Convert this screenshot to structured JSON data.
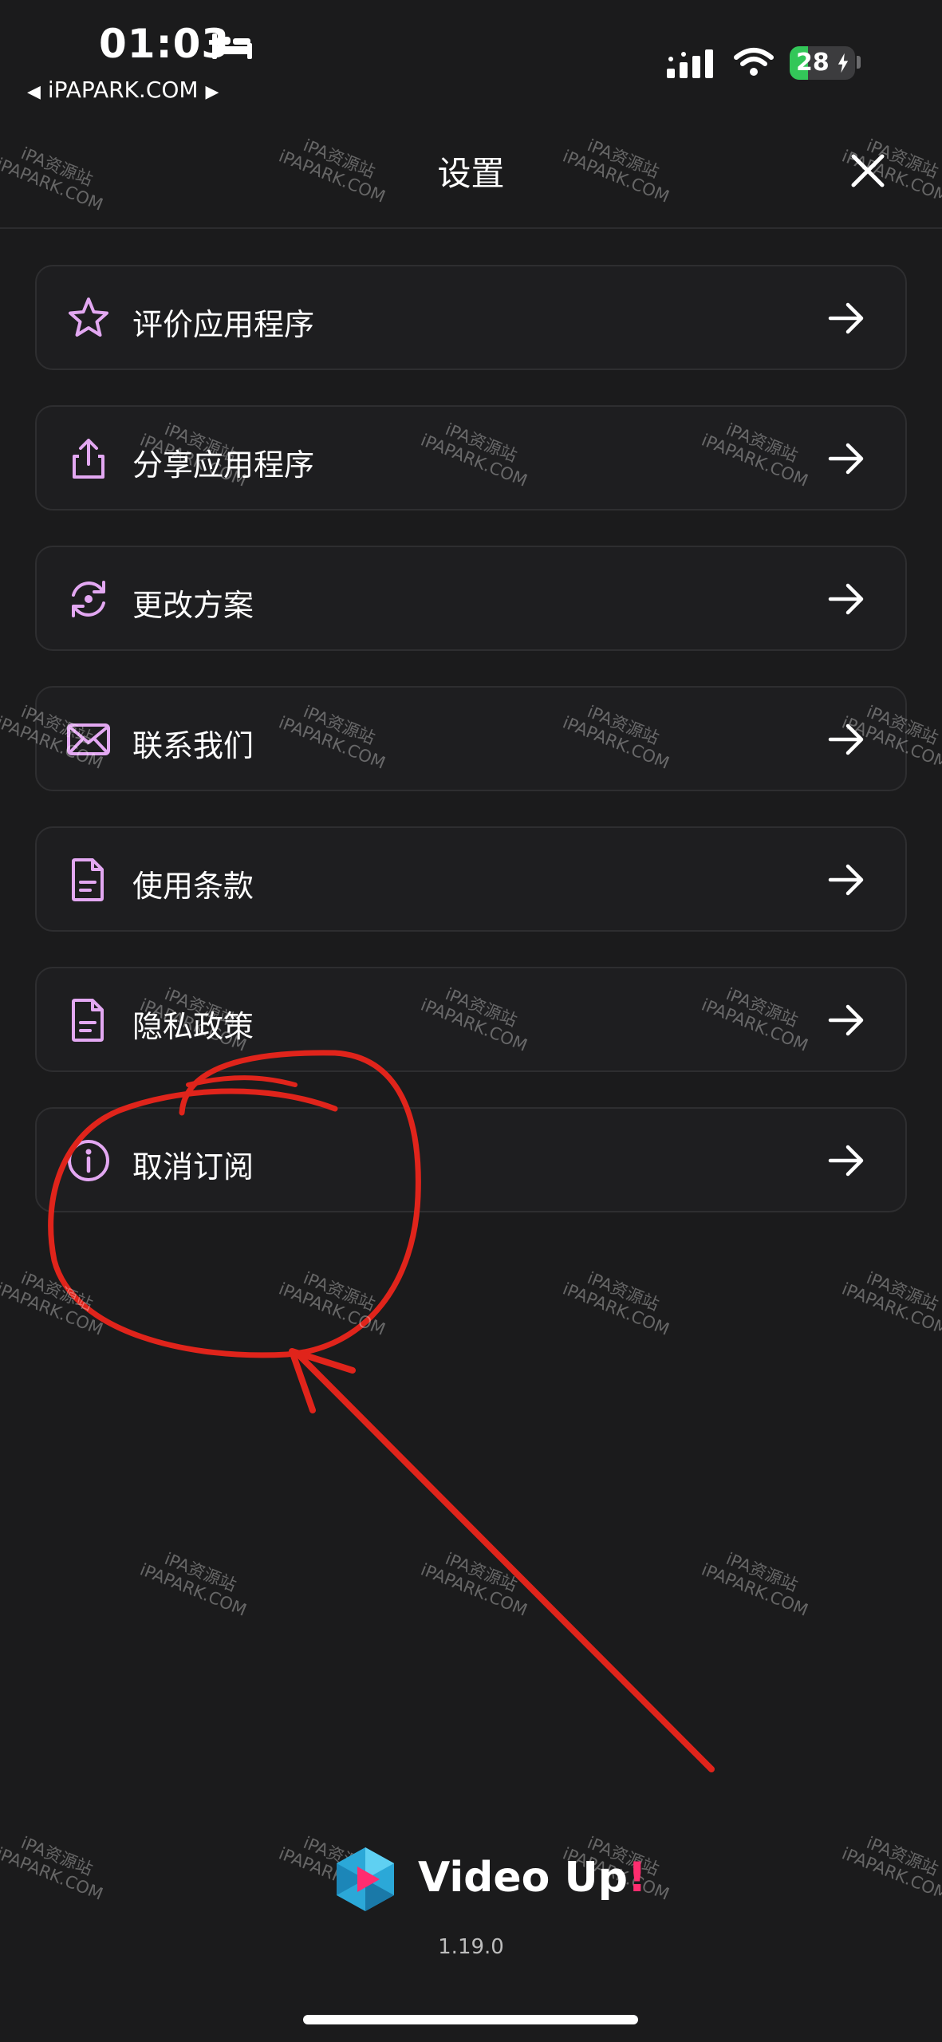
{
  "status_bar": {
    "time": "01:03",
    "back_arrow": "◀",
    "back_label": "iPAPARK.COM",
    "forward_arrow": "▶",
    "battery_level": "28",
    "battery_percent": 28,
    "icons": [
      "bed-icon",
      "signal-icon",
      "wifi-icon",
      "battery-charging-icon"
    ]
  },
  "header": {
    "title": "设置",
    "close_icon": "close-icon"
  },
  "settings": [
    {
      "label": "评价应用程序",
      "icon": "star-icon"
    },
    {
      "label": "分享应用程序",
      "icon": "share-icon"
    },
    {
      "label": "更改方案",
      "icon": "refresh-icon"
    },
    {
      "label": "联系我们",
      "icon": "mail-icon"
    },
    {
      "label": "使用条款",
      "icon": "document-icon"
    },
    {
      "label": "隐私政策",
      "icon": "document-icon"
    },
    {
      "label": "取消订阅",
      "icon": "info-icon"
    }
  ],
  "footer": {
    "app_name": "Video Up",
    "app_name_accent": "!",
    "version": "1.19.0"
  },
  "watermark": {
    "line1": "iPA资源站",
    "line2": "iPAPARK.COM"
  },
  "colors": {
    "background": "#1b1b1c",
    "item_border": "#2e2e30",
    "icon_purple": "#e3a8f2",
    "annotation_red": "#e0241b",
    "accent_pink": "#ff2d6f",
    "battery_green": "#33c759"
  }
}
